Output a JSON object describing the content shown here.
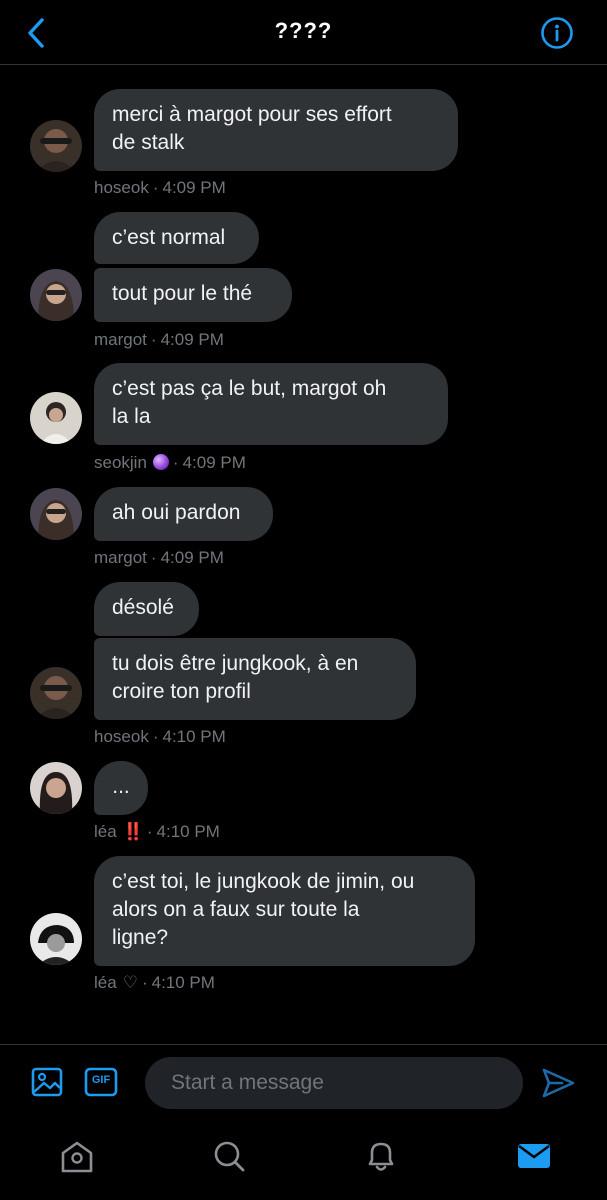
{
  "header": {
    "title": "????",
    "back_icon": "chevron-left-icon",
    "info_icon": "info-icon"
  },
  "colors": {
    "accent": "#1d9bf0",
    "bubble": "#2f3336",
    "meta": "#71767b",
    "background": "#000000"
  },
  "messages": [
    {
      "sender": "hoseok",
      "time": "4:09 PM",
      "bubbles": [
        "merci à margot pour ses effort\nde stalk"
      ]
    },
    {
      "sender": "margot",
      "time": "4:09 PM",
      "bubbles": [
        "c’est normal",
        "tout pour le thé"
      ]
    },
    {
      "sender": "seokjin",
      "badge": "🔮",
      "time": "4:09 PM",
      "bubbles": [
        "c’est pas ça le but, margot oh\nla la"
      ]
    },
    {
      "sender": "margot",
      "time": "4:09 PM",
      "bubbles": [
        "ah oui pardon"
      ]
    },
    {
      "sender": "hoseok",
      "time": "4:10 PM",
      "bubbles": [
        "désolé",
        "tu dois être jungkook, à en\ncroire ton profil"
      ]
    },
    {
      "sender": "léa",
      "badge": "‼️",
      "time": "4:10 PM",
      "bubbles": [
        "..."
      ]
    },
    {
      "sender": "léa",
      "badge": "♡",
      "time": "4:10 PM",
      "bubbles": [
        "c’est toi, le jungkook de jimin, ou\nalors on a faux sur toute la\nligne?"
      ]
    }
  ],
  "meta_separator": "·",
  "composer": {
    "placeholder": "Start a message",
    "image_icon": "image-icon",
    "gif_label": "GIF",
    "send_icon": "send-icon"
  },
  "tabbar": {
    "items": [
      "home-icon",
      "search-icon",
      "notifications-icon",
      "messages-icon"
    ],
    "active": "messages-icon"
  }
}
